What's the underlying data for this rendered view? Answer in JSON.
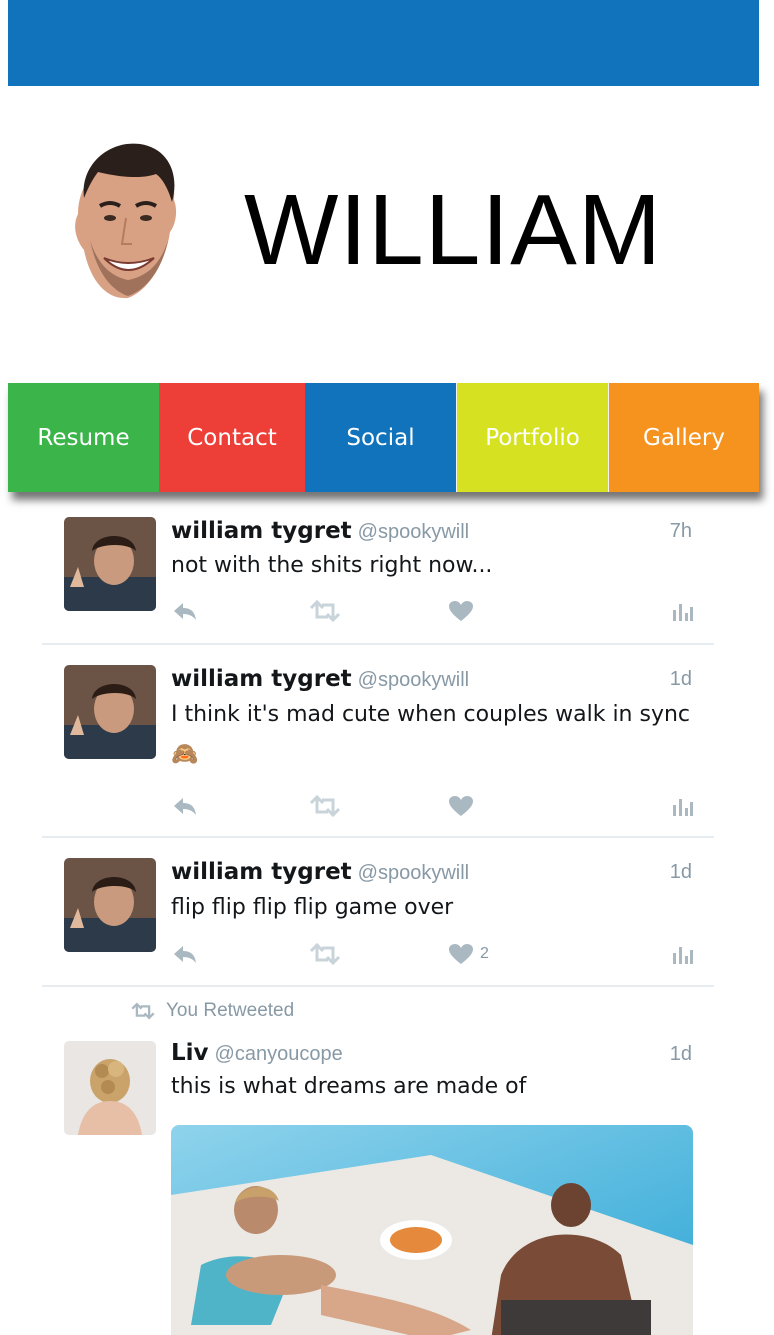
{
  "header": {
    "name": "WILLIAM"
  },
  "nav": {
    "items": [
      {
        "label": "Resume",
        "color": "#3bb54a"
      },
      {
        "label": "Contact",
        "color": "#ee3e38"
      },
      {
        "label": "Social",
        "color": "#1173bb"
      },
      {
        "label": "Portfolio",
        "color": "#d6e121"
      },
      {
        "label": "Gallery",
        "color": "#f6921e"
      }
    ]
  },
  "feed": {
    "tweets": [
      {
        "name": "william tygret",
        "handle": "@spookywill",
        "time": "7h",
        "text": "not with the shits right now..."
      },
      {
        "name": "william tygret",
        "handle": "@spookywill",
        "time": "1d",
        "text": "I think it's mad cute when couples walk in sync 🙈"
      },
      {
        "name": "william tygret",
        "handle": "@spookywill",
        "time": "1d",
        "text": "flip flip flip flip game over",
        "likes": "2"
      }
    ],
    "retweet": {
      "context": "You Retweeted",
      "name": "Liv",
      "handle": "@canyoucope",
      "time": "1d",
      "text": "this is what dreams are made of"
    }
  },
  "colors": {
    "brand_blue": "#1173bb",
    "muted": "#8899a6"
  },
  "icons": [
    "reply-icon",
    "retweet-icon",
    "heart-icon",
    "analytics-icon"
  ]
}
